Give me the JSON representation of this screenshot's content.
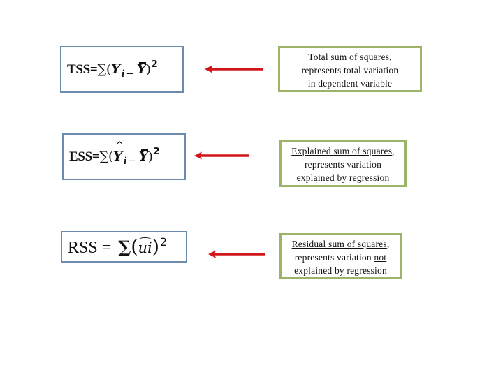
{
  "colors": {
    "formula_border": "#6d8bad",
    "description_border": "#9bb46a",
    "arrow": "#d0161b"
  },
  "rows": [
    {
      "id": "tss",
      "formula": {
        "label": "TSS=",
        "sum": "∑",
        "open": "(",
        "term_a": "Y",
        "term_a_sub": "i",
        "minus": "–",
        "term_b": "Y",
        "close": ")",
        "power": "2"
      },
      "description": {
        "title": "Total sum of squares",
        "title_suffix": ",",
        "line2": "represents total variation",
        "line3": "in dependent variable"
      }
    },
    {
      "id": "ess",
      "formula": {
        "label": "ESS=",
        "sum": "∑",
        "open": "(",
        "term_a": "Y",
        "term_a_sub": "i",
        "minus": "–",
        "term_b": "Y",
        "close": ")",
        "power": "2"
      },
      "description": {
        "title": "Explained sum of squares",
        "title_suffix": ",",
        "line2": "represents variation",
        "line3": "explained by regression"
      }
    },
    {
      "id": "rss",
      "formula": {
        "label": "RSS = ",
        "sum": "∑",
        "open": "(",
        "term": "ui",
        "close": ")",
        "power": "2"
      },
      "description": {
        "title": "Residual sum of squares",
        "title_suffix": ",",
        "line2_prefix": "represents variation ",
        "line2_emphasis": "not",
        "line3": "explained by regression"
      }
    }
  ]
}
